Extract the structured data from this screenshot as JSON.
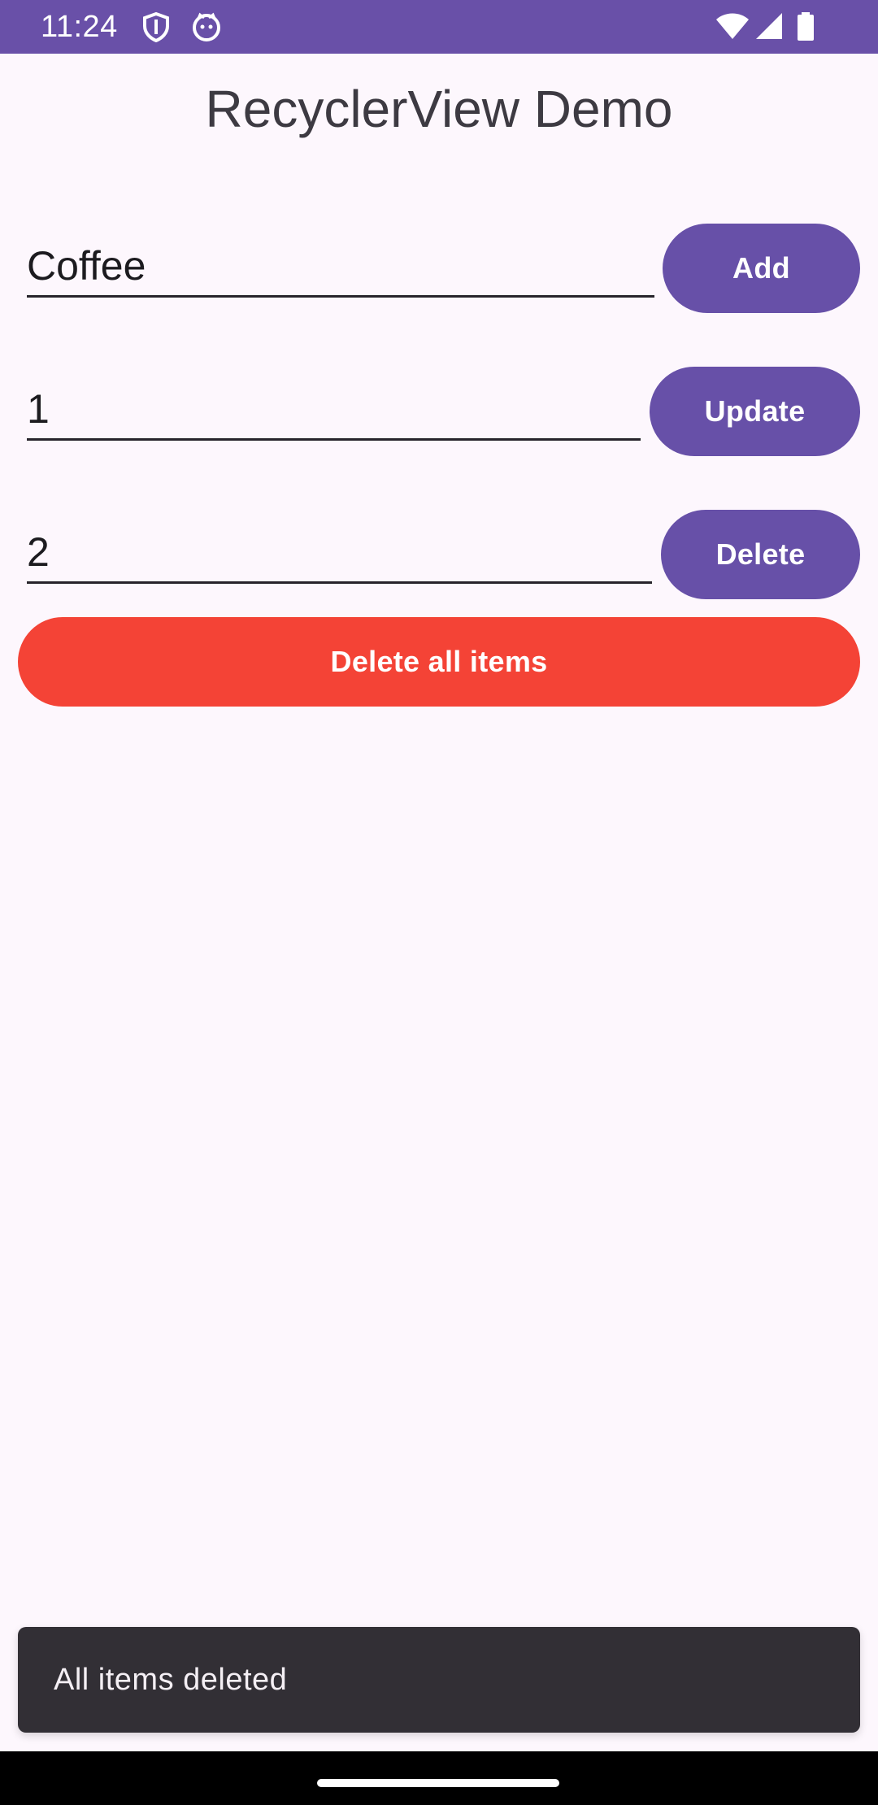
{
  "status_bar": {
    "time": "11:24",
    "background": "#6950A8",
    "icons_left": [
      "shield-icon",
      "cat-face-icon"
    ],
    "icons_right": [
      "wifi-icon",
      "cellular-signal-icon",
      "battery-icon"
    ]
  },
  "app": {
    "title": "RecyclerView Demo"
  },
  "add_row": {
    "input_value": "Coffee",
    "button_label": "Add"
  },
  "update_row": {
    "input_value": "1",
    "button_label": "Update"
  },
  "delete_row": {
    "input_value": "2",
    "button_label": "Delete"
  },
  "delete_all": {
    "label": "Delete all items",
    "color": "#F44336"
  },
  "snackbar": {
    "message": "All items deleted"
  },
  "colors": {
    "primary": "#6750A8",
    "background": "#FDF7FD",
    "danger": "#F44336",
    "snackbar": "#322F35"
  }
}
